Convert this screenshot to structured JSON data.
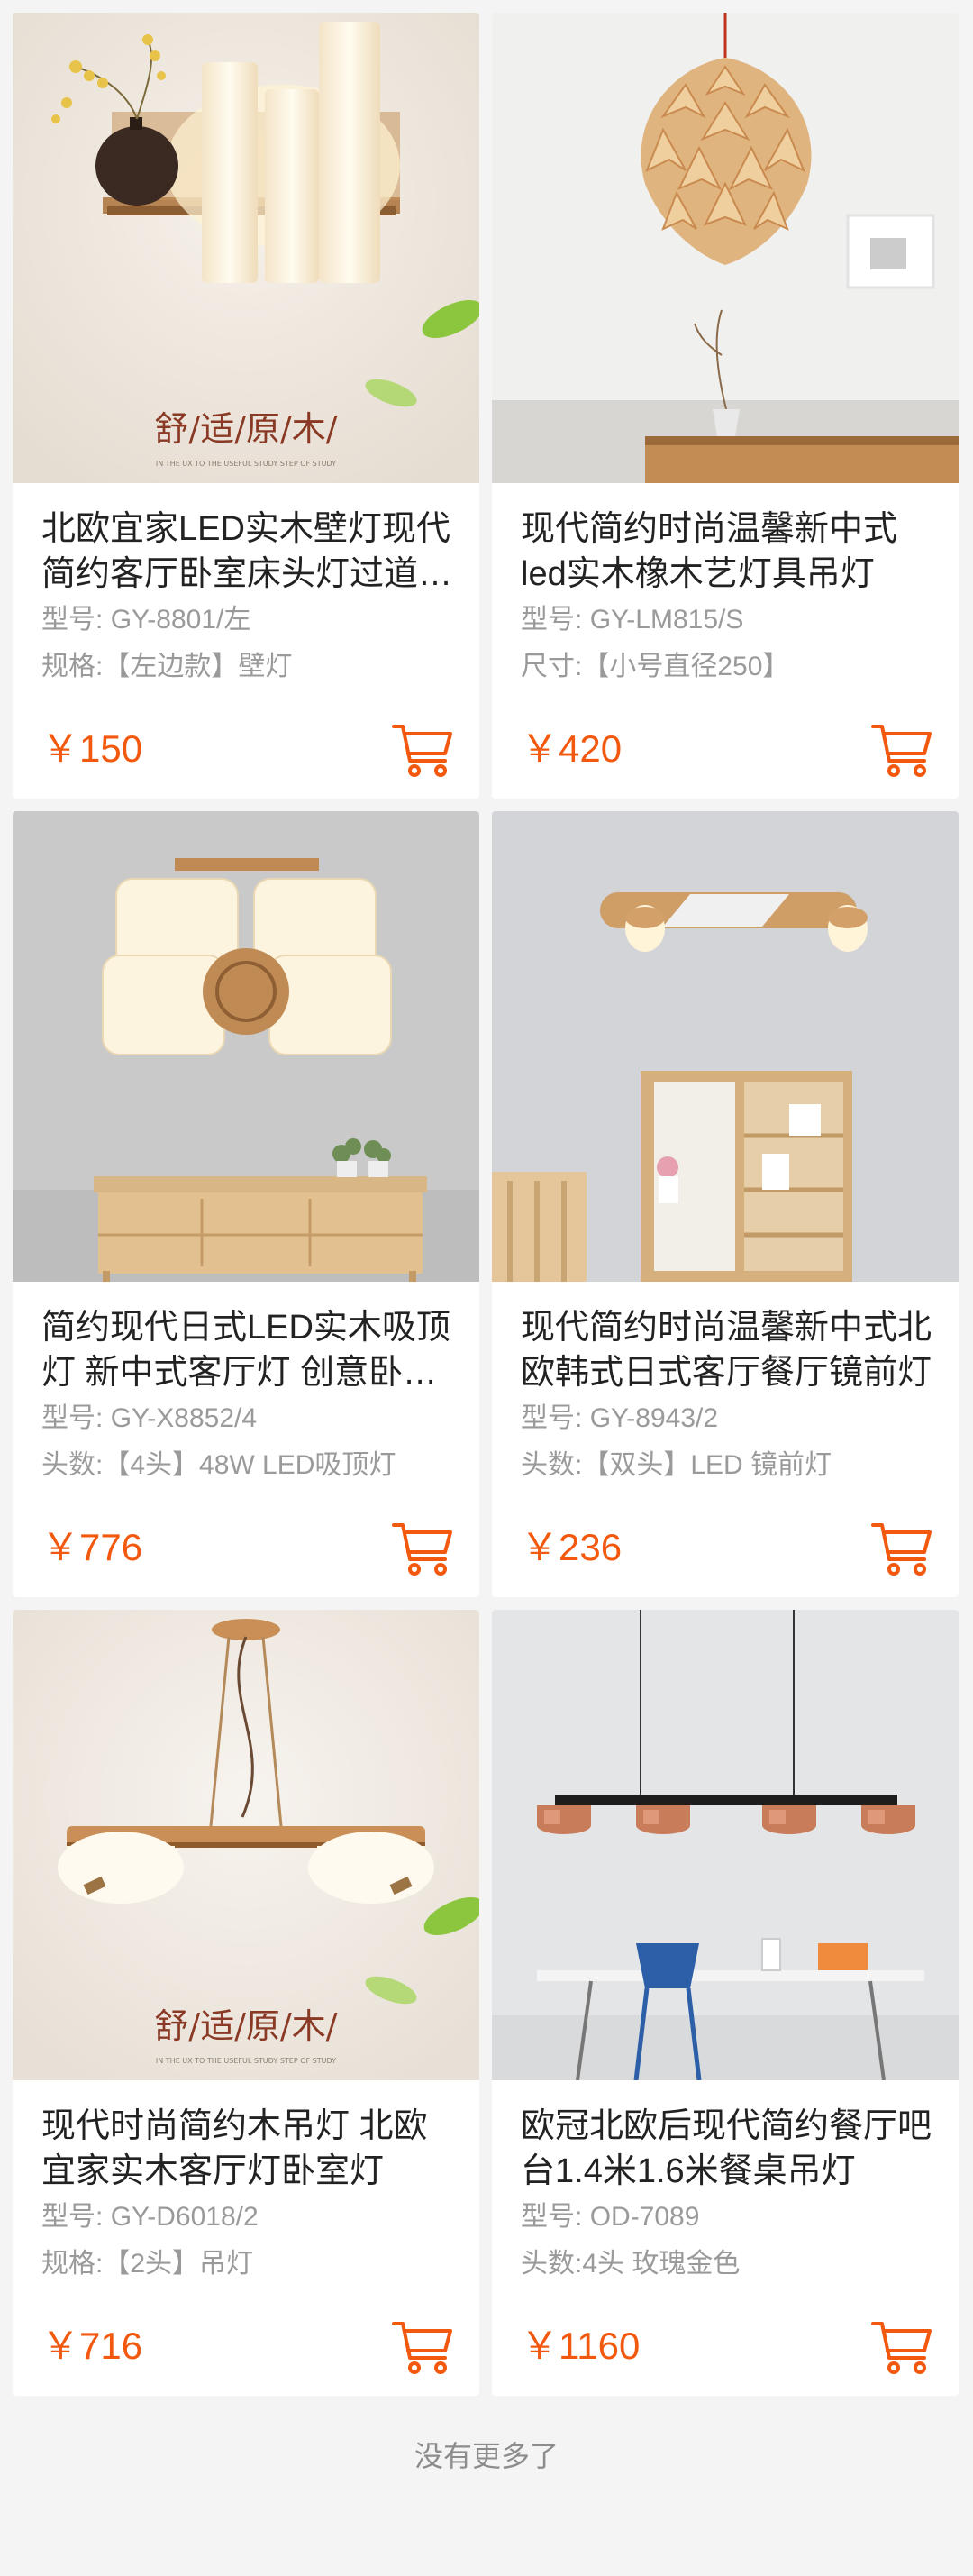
{
  "products": [
    {
      "title": "北欧宜家LED实木壁灯现代简约客厅卧室床头灯过道楼梯灯",
      "spec1_label": "型号:",
      "spec1_value": "GY-8801/左",
      "spec2_label": "规格:",
      "spec2_value": "【左边款】壁灯",
      "price": "￥150",
      "image_text": "舒/适/原/木/",
      "image_subtext": "IN THE UX TO THE USEFUL STUDY STEP OF STUDY"
    },
    {
      "title": "现代简约时尚温馨新中式led实木橡木艺灯具吊灯",
      "spec1_label": "型号:",
      "spec1_value": "GY-LM815/S",
      "spec2_label": "尺寸:",
      "spec2_value": "【小号直径250】",
      "price": "￥420"
    },
    {
      "title": "简约现代日式LED实木吸顶灯 新中式客厅灯 创意卧室灯",
      "spec1_label": "型号:",
      "spec1_value": "GY-X8852/4",
      "spec2_label": "头数:",
      "spec2_value": "【4头】48W LED吸顶灯",
      "price": "￥776"
    },
    {
      "title": "现代简约时尚温馨新中式北欧韩式日式客厅餐厅镜前灯",
      "spec1_label": "型号:",
      "spec1_value": "GY-8943/2",
      "spec2_label": "头数:",
      "spec2_value": "【双头】LED 镜前灯",
      "price": "￥236"
    },
    {
      "title": "现代时尚简约木吊灯 北欧宜家实木客厅灯卧室灯",
      "spec1_label": "型号:",
      "spec1_value": "GY-D6018/2",
      "spec2_label": "规格:",
      "spec2_value": "【2头】吊灯",
      "price": "￥716",
      "image_text": "舒/适/原/木/",
      "image_subtext": "IN THE UX TO THE USEFUL STUDY STEP OF STUDY"
    },
    {
      "title": "欧冠北欧后现代简约餐厅吧台1.4米1.6米餐桌吊灯",
      "spec1_label": "型号:",
      "spec1_value": "OD-7089",
      "spec2_label": "头数:4头",
      "spec2_value": "玫瑰金色",
      "price": "￥1160"
    }
  ],
  "footer_text": "没有更多了",
  "colors": {
    "price": "#f2580e",
    "cart_icon": "#f2580e",
    "page_bg": "#f4f4f4"
  },
  "icons": {
    "cart": "shopping-cart-icon"
  }
}
